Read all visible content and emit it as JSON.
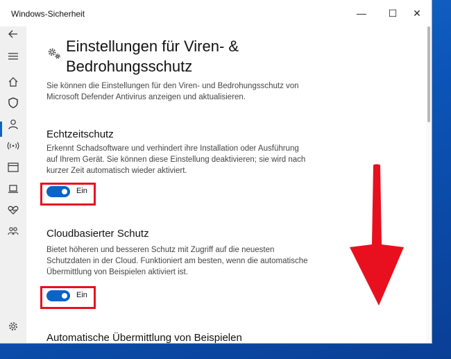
{
  "window": {
    "title": "Windows-Sicherheit",
    "minimize_glyph": "—",
    "maximize_glyph": "☐",
    "close_glyph": "✕"
  },
  "sidebar": {
    "items": [
      {
        "icon": "back-arrow-icon"
      },
      {
        "icon": "hamburger-menu-icon"
      },
      {
        "icon": "home-icon"
      },
      {
        "icon": "shield-icon",
        "active": true
      },
      {
        "icon": "person-icon"
      },
      {
        "icon": "wireless-icon"
      },
      {
        "icon": "app-browser-icon"
      },
      {
        "icon": "laptop-icon"
      },
      {
        "icon": "heart-icon"
      },
      {
        "icon": "family-icon"
      },
      {
        "icon": "gear-icon"
      }
    ]
  },
  "page": {
    "icon": "settings-gears-icon",
    "title_line1": "Einstellungen für Viren- &",
    "title_line2": "Bedrohungsschutz",
    "intro": "Sie können die Einstellungen für den Viren- und Bedrohungsschutz von Microsoft Defender Antivirus anzeigen und aktualisieren."
  },
  "sections": [
    {
      "heading": "Echtzeitschutz",
      "description": "Erkennt Schadsoftware und verhindert ihre Installation oder Ausführung auf Ihrem Gerät. Sie können diese Einstellung deaktivieren; sie wird nach kurzer Zeit automatisch wieder aktiviert.",
      "toggle_state": "on",
      "toggle_label": "Ein"
    },
    {
      "heading": "Cloudbasierter Schutz",
      "description": "Bietet höheren und besseren Schutz mit Zugriff auf die neuesten Schutzdaten in der Cloud. Funktioniert am besten, wenn die automatische Übermittlung von Beispielen aktiviert ist.",
      "toggle_state": "on",
      "toggle_label": "Ein"
    },
    {
      "heading": "Automatische Übermittlung von Beispielen"
    }
  ],
  "colors": {
    "accent": "#0a63c8",
    "highlight": "#e8101e",
    "desktop": "#0b55b8"
  }
}
